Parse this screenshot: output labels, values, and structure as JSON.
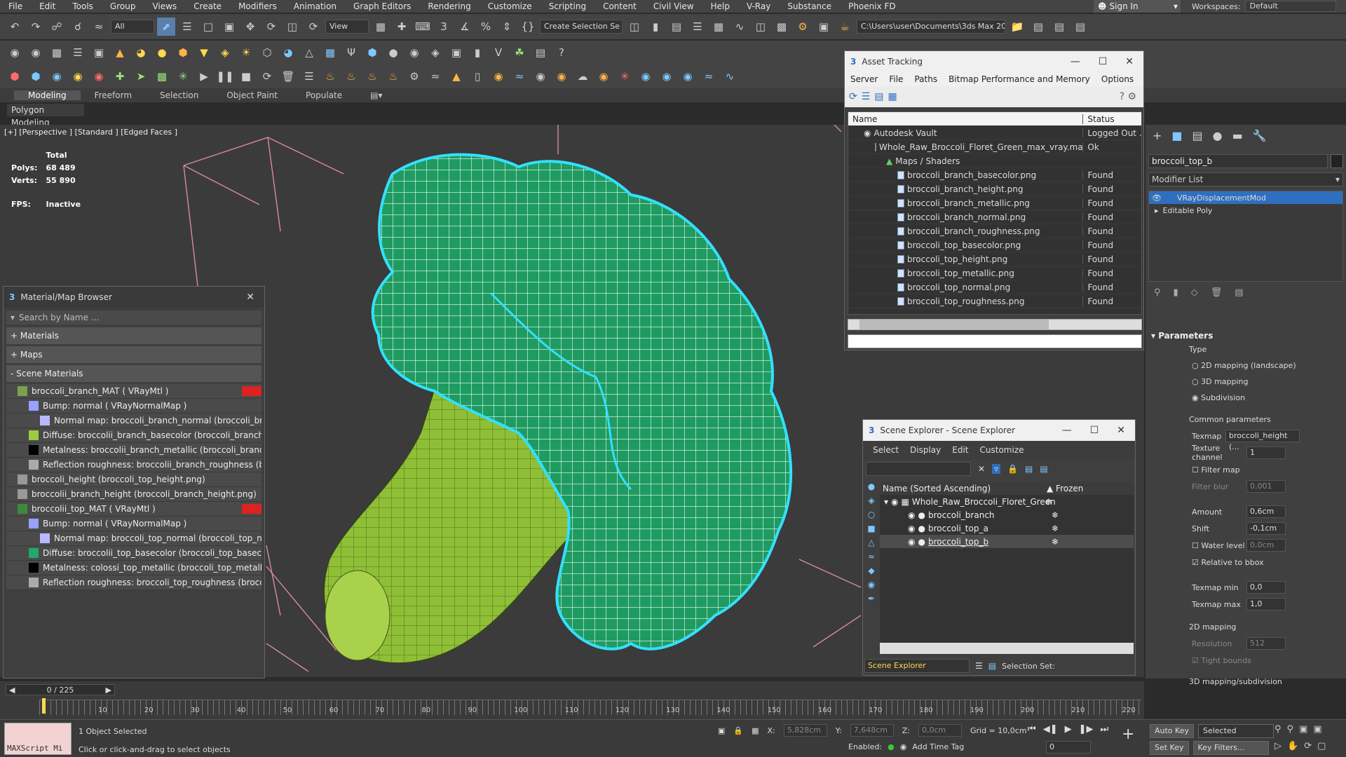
{
  "menu": [
    "File",
    "Edit",
    "Tools",
    "Group",
    "Views",
    "Create",
    "Modifiers",
    "Animation",
    "Graph Editors",
    "Rendering",
    "Customize",
    "Scripting",
    "Content",
    "Civil View",
    "Help",
    "V-Ray",
    "Substance",
    "Phoenix FD"
  ],
  "account": {
    "signin": "Sign In",
    "workspaces_label": "Workspaces:",
    "workspace_value": "Default"
  },
  "toolbar": {
    "filter_all": "All",
    "view": "View",
    "create_selection": "Create Selection Se",
    "project_path": "C:\\Users\\user\\Documents\\3ds Max 2022"
  },
  "ribbon": {
    "tabs": [
      "Modeling",
      "Freeform",
      "Selection",
      "Object Paint",
      "Populate"
    ],
    "active": "Modeling",
    "sub": "Polygon Modeling"
  },
  "viewport": {
    "label": "[+] [Perspective ] [Standard ] [Edged Faces ]",
    "stats": {
      "total": "Total",
      "polys_label": "Polys:",
      "polys": "68 489",
      "verts_label": "Verts:",
      "verts": "55 890",
      "fps_label": "FPS:",
      "fps": "Inactive"
    }
  },
  "asset_tracking": {
    "title": "Asset Tracking",
    "menu": [
      "Server",
      "File",
      "Paths",
      "Bitmap Performance and Memory",
      "Options"
    ],
    "col_name": "Name",
    "col_status": "Status",
    "rows": [
      {
        "name": "Autodesk Vault",
        "status": "Logged Out ..."
      },
      {
        "name": "Whole_Raw_Broccoli_Floret_Green_max_vray.max",
        "status": "Ok"
      },
      {
        "name": "Maps / Shaders",
        "status": ""
      },
      {
        "name": "broccoli_branch_basecolor.png",
        "status": "Found"
      },
      {
        "name": "broccoli_branch_height.png",
        "status": "Found"
      },
      {
        "name": "broccoli_branch_metallic.png",
        "status": "Found"
      },
      {
        "name": "broccoli_branch_normal.png",
        "status": "Found"
      },
      {
        "name": "broccoli_branch_roughness.png",
        "status": "Found"
      },
      {
        "name": "broccoli_top_basecolor.png",
        "status": "Found"
      },
      {
        "name": "broccoli_top_height.png",
        "status": "Found"
      },
      {
        "name": "broccoli_top_metallic.png",
        "status": "Found"
      },
      {
        "name": "broccoli_top_normal.png",
        "status": "Found"
      },
      {
        "name": "broccoli_top_roughness.png",
        "status": "Found"
      }
    ]
  },
  "material_browser": {
    "title": "Material/Map Browser",
    "search_placeholder": "Search by Name ...",
    "sections": [
      "+ Materials",
      "+ Maps",
      "- Scene Materials"
    ],
    "rows": [
      "broccoli_branch_MAT  ( VRayMtl )",
      "Bump: normal  ( VRayNormalMap )",
      "Normal map: broccoli_branch_normal (broccoli_branch...",
      "Diffuse: broccolii_branch_basecolor (broccoli_branch_base...",
      "Metalness: broccolii_branch_metallic (broccoli_branch_me...",
      "Reflection roughness: broccolii_branch_roughness (brocco...",
      "broccoli_height (broccoli_top_height.png)",
      "broccolii_branch_height (broccoli_branch_height.png)",
      "broccolii_top_MAT  ( VRayMtl )",
      "Bump: normal  ( VRayNormalMap )",
      "Normal map: broccoli_top_normal (broccoli_top_norma...",
      "Diffuse: broccolii_top_basecolor (broccoli_top_basecolorp...",
      "Metalness: colossi_top_metallic (broccoli_top_metallic.png)",
      "Reflection roughness: broccoli_top_roughness (broccoli_to..."
    ]
  },
  "command_panel": {
    "object_name": "broccoli_top_b",
    "modifier_list": "Modifier List",
    "stack": [
      "VRayDisplacementMod",
      "Editable Poly"
    ],
    "parameters": "Parameters",
    "type_label": "Type",
    "types": [
      "2D mapping (landscape)",
      "3D mapping",
      "Subdivision"
    ],
    "common": "Common parameters",
    "texmap_label": "Texmap",
    "texmap": "broccoli_height (...",
    "texture_channel_label": "Texture channel",
    "texture_channel": "1",
    "filter_map": "Filter map",
    "filter_blur_label": "Filter blur",
    "filter_blur": "0,001",
    "amount_label": "Amount",
    "amount": "0,6cm",
    "shift_label": "Shift",
    "shift": "-0,1cm",
    "water_level_label": "Water level",
    "water_level": "0,0cm",
    "relative_bbox": "Relative to bbox",
    "texmap_min_label": "Texmap min",
    "texmap_min": "0,0",
    "texmap_max_label": "Texmap max",
    "texmap_max": "1,0",
    "mapping2d": "2D mapping",
    "resolution_label": "Resolution",
    "resolution": "512",
    "tight_bounds": "Tight bounds",
    "mapping3d": "3D mapping/subdivision"
  },
  "scene_explorer": {
    "title": "Scene Explorer - Scene Explorer",
    "menu": [
      "Select",
      "Display",
      "Edit",
      "Customize"
    ],
    "col_name": "Name (Sorted Ascending)",
    "col_frozen": "▲ Frozen",
    "rows": [
      "Whole_Raw_Broccoli_Floret_Green",
      "broccoli_branch",
      "broccoli_top_a",
      "broccoli_top_b"
    ],
    "footer": "Scene Explorer",
    "selection_set": "Selection Set:"
  },
  "timeline": {
    "frame": "0 / 225",
    "ticks": [
      "10",
      "20",
      "30",
      "40",
      "50",
      "60",
      "70",
      "80",
      "90",
      "100",
      "110",
      "120",
      "130",
      "140",
      "150",
      "160",
      "170",
      "180",
      "190",
      "200",
      "210",
      "220"
    ]
  },
  "status": {
    "maxscript": "MAXScript Mi",
    "selected": "1 Object Selected",
    "hint": "Click or click-and-drag to select objects",
    "x_label": "X:",
    "x": "5,828cm",
    "y_label": "Y:",
    "y": "7,648cm",
    "z_label": "Z:",
    "z": "0,0cm",
    "grid": "Grid = 10,0cm",
    "enabled": "Enabled:",
    "add_time_tag": "Add Time Tag",
    "auto_key": "Auto Key",
    "selected_mode": "Selected",
    "set_key": "Set Key",
    "key_filters": "Key Filters...",
    "frame": "0"
  },
  "colors": {
    "accent": "#2f6fbf",
    "mesh_green": "#22a86a",
    "wire_cyan": "#33e0ff",
    "stem_green": "#9ccb3f"
  }
}
